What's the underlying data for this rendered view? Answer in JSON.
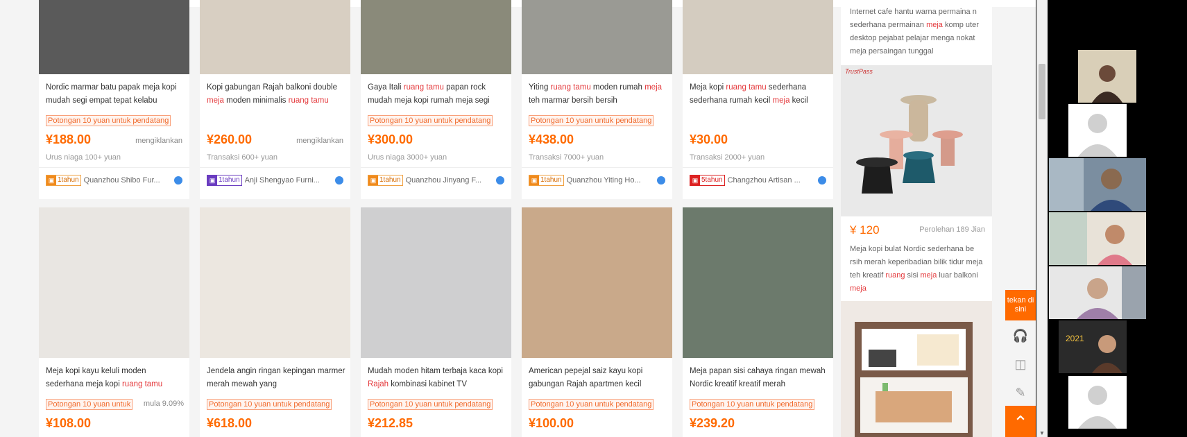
{
  "products_row1": [
    {
      "title_parts": [
        [
          "Nordic marmar batu papak meja kopi mudah segi empat tepat kelabu",
          false
        ]
      ],
      "promo": "Potongan 10 yuan untuk pendatang",
      "price": "¥188.00",
      "ad": "mengiklankan",
      "txn": "Urus niaga 100+ yuan",
      "badge_color": "orange",
      "years": "1tahun",
      "seller": "Quanzhou Shibo Fur..."
    },
    {
      "title_parts": [
        [
          "Kopi gabungan Rajah balkoni double ",
          false
        ],
        [
          "meja",
          true
        ],
        [
          " moden minimalis ",
          false
        ],
        [
          "ruang tamu",
          true
        ]
      ],
      "promo": "",
      "price": "¥260.00",
      "ad": "mengiklankan",
      "txn": "Transaksi 600+ yuan",
      "badge_color": "purple",
      "years": "1tahun",
      "seller": "Anji Shengyao Furni..."
    },
    {
      "title_parts": [
        [
          "Gaya Itali ",
          false
        ],
        [
          "ruang tamu",
          true
        ],
        [
          " papan rock mudah meja kopi rumah meja segi",
          false
        ]
      ],
      "promo": "Potongan 10 yuan untuk pendatang",
      "price": "¥300.00",
      "ad": "",
      "txn": "Urus niaga 3000+ yuan",
      "badge_color": "orange",
      "years": "1tahun",
      "seller": "Quanzhou Jinyang F..."
    },
    {
      "title_parts": [
        [
          "Yiting ",
          false
        ],
        [
          "ruang tamu",
          true
        ],
        [
          " moden rumah ",
          false
        ],
        [
          "meja",
          true
        ],
        [
          " teh marmar bersih bersih",
          false
        ]
      ],
      "promo": "Potongan 10 yuan untuk pendatang",
      "price": "¥438.00",
      "ad": "",
      "txn": "Transaksi 7000+ yuan",
      "badge_color": "orange",
      "years": "1tahun",
      "seller": "Quanzhou Yiting Ho..."
    },
    {
      "title_parts": [
        [
          "Meja kopi ",
          false
        ],
        [
          "ruang tamu",
          true
        ],
        [
          " sederhana sederhana rumah kecil ",
          false
        ],
        [
          "meja",
          true
        ],
        [
          " kecil",
          false
        ]
      ],
      "promo": "",
      "price": "¥30.00",
      "ad": "",
      "txn": "Transaksi 2000+ yuan",
      "badge_color": "red",
      "years": "5tahun",
      "seller": "Changzhou Artisan ..."
    }
  ],
  "products_row2": [
    {
      "title_parts": [
        [
          "Meja kopi kayu keluli moden sederhana meja kopi ",
          false
        ],
        [
          "ruang tamu",
          true
        ]
      ],
      "promo": "Potongan 10 yuan untuk",
      "extra": "mula 9.09%",
      "price": "¥108.00"
    },
    {
      "title_parts": [
        [
          "Jendela angin ringan kepingan marmer merah mewah yang",
          false
        ]
      ],
      "promo": "Potongan 10 yuan untuk pendatang",
      "price": "¥618.00"
    },
    {
      "title_parts": [
        [
          "Mudah moden hitam terbaja kaca kopi ",
          false
        ],
        [
          "Rajah",
          true
        ],
        [
          " kombinasi kabinet TV",
          false
        ]
      ],
      "promo": "Potongan 10 yuan untuk pendatang",
      "price": "¥212.85"
    },
    {
      "title_parts": [
        [
          "American pepejal saiz kayu kopi gabungan Rajah apartmen kecil",
          false
        ]
      ],
      "promo": "Potongan 10 yuan untuk pendatang",
      "price": "¥100.00"
    },
    {
      "title_parts": [
        [
          "Meja papan sisi cahaya ringan mewah Nordic kreatif kreatif merah",
          false
        ]
      ],
      "promo": "Potongan 10 yuan untuk pendatang",
      "price": "¥239.20"
    }
  ],
  "sidebar": {
    "top_text_parts": [
      [
        "Internet cafe hantu warna permaina n sederhana permainan ",
        false
      ],
      [
        "meja",
        true
      ],
      [
        " komp uter desktop pejabat pelajar menga nokat meja persaingan tunggal",
        false
      ]
    ],
    "logo_text": "TrustPass",
    "price": "¥ 120",
    "sales": "Perolehan 189 Jian",
    "desc_parts": [
      [
        "Meja kopi bulat Nordic sederhana be rsih merah keperibadian bilik tidur meja teh kreatif ",
        false
      ],
      [
        "ruang",
        true
      ],
      [
        " sisi ",
        false
      ],
      [
        "meja",
        true
      ],
      [
        " luar balkoni ",
        false
      ],
      [
        "meja",
        true
      ]
    ]
  },
  "tools": {
    "tekan": "tekan di sini",
    "headset_icon": "headset-icon",
    "phone_icon": "phone-icon",
    "note_icon": "note-icon",
    "top_icon": "back-to-top-icon"
  },
  "video_call": {
    "participants": [
      "participant-1",
      "participant-2",
      "participant-3",
      "participant-4",
      "participant-5",
      "participant-6",
      "participant-7"
    ]
  }
}
